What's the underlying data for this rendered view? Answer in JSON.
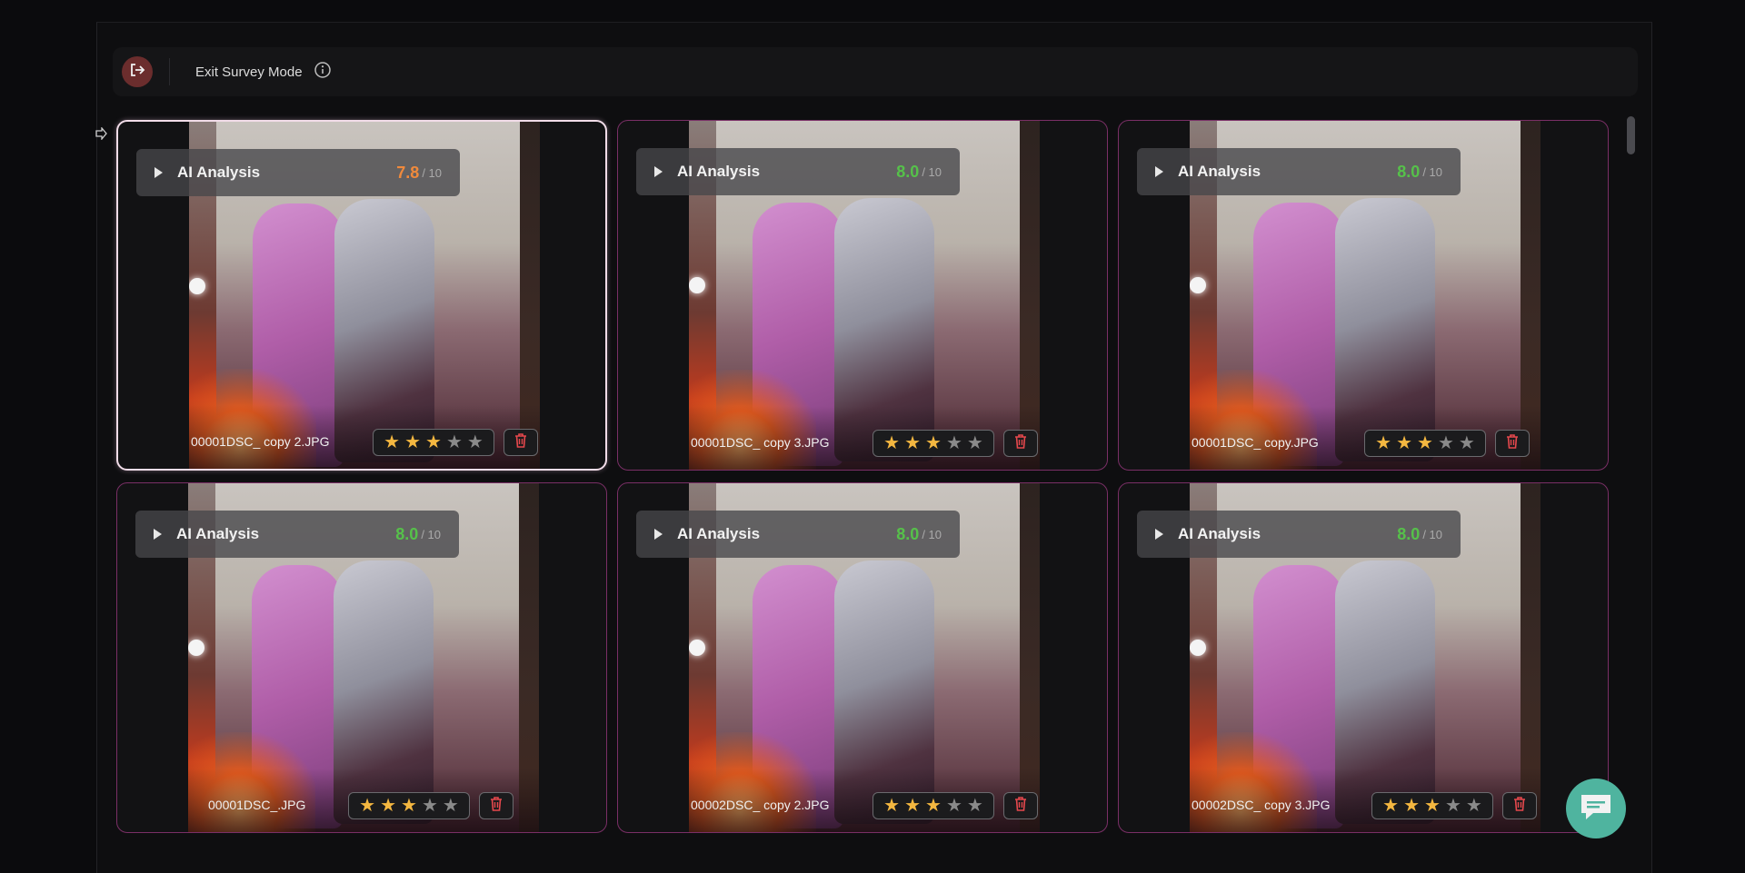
{
  "toolbar": {
    "exit_label": "Exit Survey Mode"
  },
  "ai": {
    "label": "AI Analysis",
    "denominator": "/ 10"
  },
  "colors": {
    "score_high": "#56c14a",
    "score_mid": "#f08a3c",
    "star_on": "#f4b740",
    "card_border": "#7a2f66"
  },
  "cards": [
    {
      "filename": "00001DSC_ copy 2.JPG",
      "score": "7.8",
      "score_color": "#f08a3c",
      "rating": 3,
      "selected": true
    },
    {
      "filename": "00001DSC_ copy 3.JPG",
      "score": "8.0",
      "score_color": "#56c14a",
      "rating": 3,
      "selected": false
    },
    {
      "filename": "00001DSC_ copy.JPG",
      "score": "8.0",
      "score_color": "#56c14a",
      "rating": 3,
      "selected": false
    },
    {
      "filename": "00001DSC_.JPG",
      "score": "8.0",
      "score_color": "#56c14a",
      "rating": 3,
      "selected": false
    },
    {
      "filename": "00002DSC_ copy 2.JPG",
      "score": "8.0",
      "score_color": "#56c14a",
      "rating": 3,
      "selected": false
    },
    {
      "filename": "00002DSC_ copy 3.JPG",
      "score": "8.0",
      "score_color": "#56c14a",
      "rating": 3,
      "selected": false
    }
  ],
  "icons": {
    "exit": "exit-icon",
    "info": "info-icon",
    "play": "play-icon",
    "star": "star-icon",
    "trash": "trash-icon",
    "chat": "chat-icon",
    "cursor": "cursor-icon"
  }
}
